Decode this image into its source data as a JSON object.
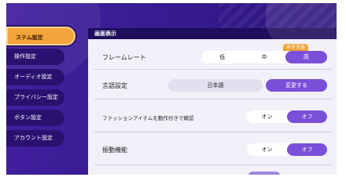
{
  "sidebar": {
    "items": [
      {
        "label": "ステム設定",
        "active": true
      },
      {
        "label": "操作設定"
      },
      {
        "label": "オーディオ設定"
      },
      {
        "label": "プライバシー設定"
      },
      {
        "label": "ボタン設定"
      },
      {
        "label": "アカウント設定"
      }
    ]
  },
  "panel": {
    "title": "画面表示",
    "frame_rate": {
      "label": "フレームレート",
      "options": [
        "低",
        "中",
        "高"
      ],
      "selected": "高",
      "badge": "おすすめ"
    },
    "language": {
      "label": "言語設定",
      "value": "日本語",
      "button": "変更する"
    },
    "fashion_motion": {
      "label": "ファッションアイテムを動作付きで確認",
      "options": [
        "オン",
        "オフ"
      ],
      "selected": "オフ"
    },
    "vibration": {
      "label": "振動機能",
      "options": [
        "オン",
        "オフ"
      ],
      "selected": "オフ"
    }
  },
  "colors": {
    "accent": "#7a50d8",
    "active_tab": "#f4a43c",
    "badge": "#f0a030",
    "background": "#3a1e8c"
  }
}
